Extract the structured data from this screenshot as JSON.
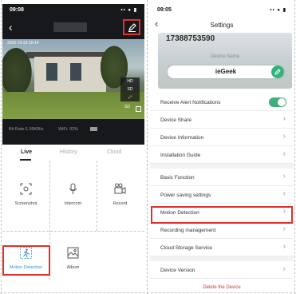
{
  "left_phone": {
    "status_time": "09:08",
    "status_icons": "•• ● ▮",
    "video_timestamp": "2020-10-23  10:14",
    "video_controls": [
      "HD",
      "SD",
      "⤢"
    ],
    "video_corner_label": "SD",
    "bitrate": "Bit Rate:1.95KB/s",
    "wifi": "WiFi: 92%",
    "tabs": [
      "Live",
      "History",
      "Cloud"
    ],
    "active_tab": "Live",
    "grid_items": [
      {
        "label": "Screenshot",
        "icon": "screenshot-icon"
      },
      {
        "label": "Intercom",
        "icon": "microphone-icon"
      },
      {
        "label": "Record",
        "icon": "video-record-icon"
      },
      {
        "label": "Motion Detection",
        "icon": "running-man-icon"
      },
      {
        "label": "Album",
        "icon": "album-icon"
      }
    ]
  },
  "right_phone": {
    "status_time": "09:05",
    "status_icons": "•• ● ▮",
    "title": "Settings",
    "device_id": "17388753590",
    "device_name_label": "Device Name",
    "device_name": "ieGeek",
    "rows": [
      {
        "label": "Receive Alert Notifications",
        "type": "toggle",
        "on": true
      },
      {
        "label": "Device Share",
        "type": "link"
      },
      {
        "label": "Device Information",
        "type": "link"
      },
      {
        "label": "Installation Guide",
        "type": "link"
      },
      {
        "label": "Basic Function",
        "type": "link"
      },
      {
        "label": "Power saving settings",
        "type": "link"
      },
      {
        "label": "Motion Detection",
        "type": "link"
      },
      {
        "label": "Recording management",
        "type": "link"
      },
      {
        "label": "Cloud Storage Service",
        "type": "link"
      },
      {
        "label": "Device Version",
        "type": "link"
      }
    ],
    "delete_label": "Delete the Device"
  },
  "colors": {
    "highlight": "#e0312a",
    "toggle_on": "#3fae7c",
    "edit_green": "#33b37a",
    "motion_blue": "#3a8fd6"
  }
}
